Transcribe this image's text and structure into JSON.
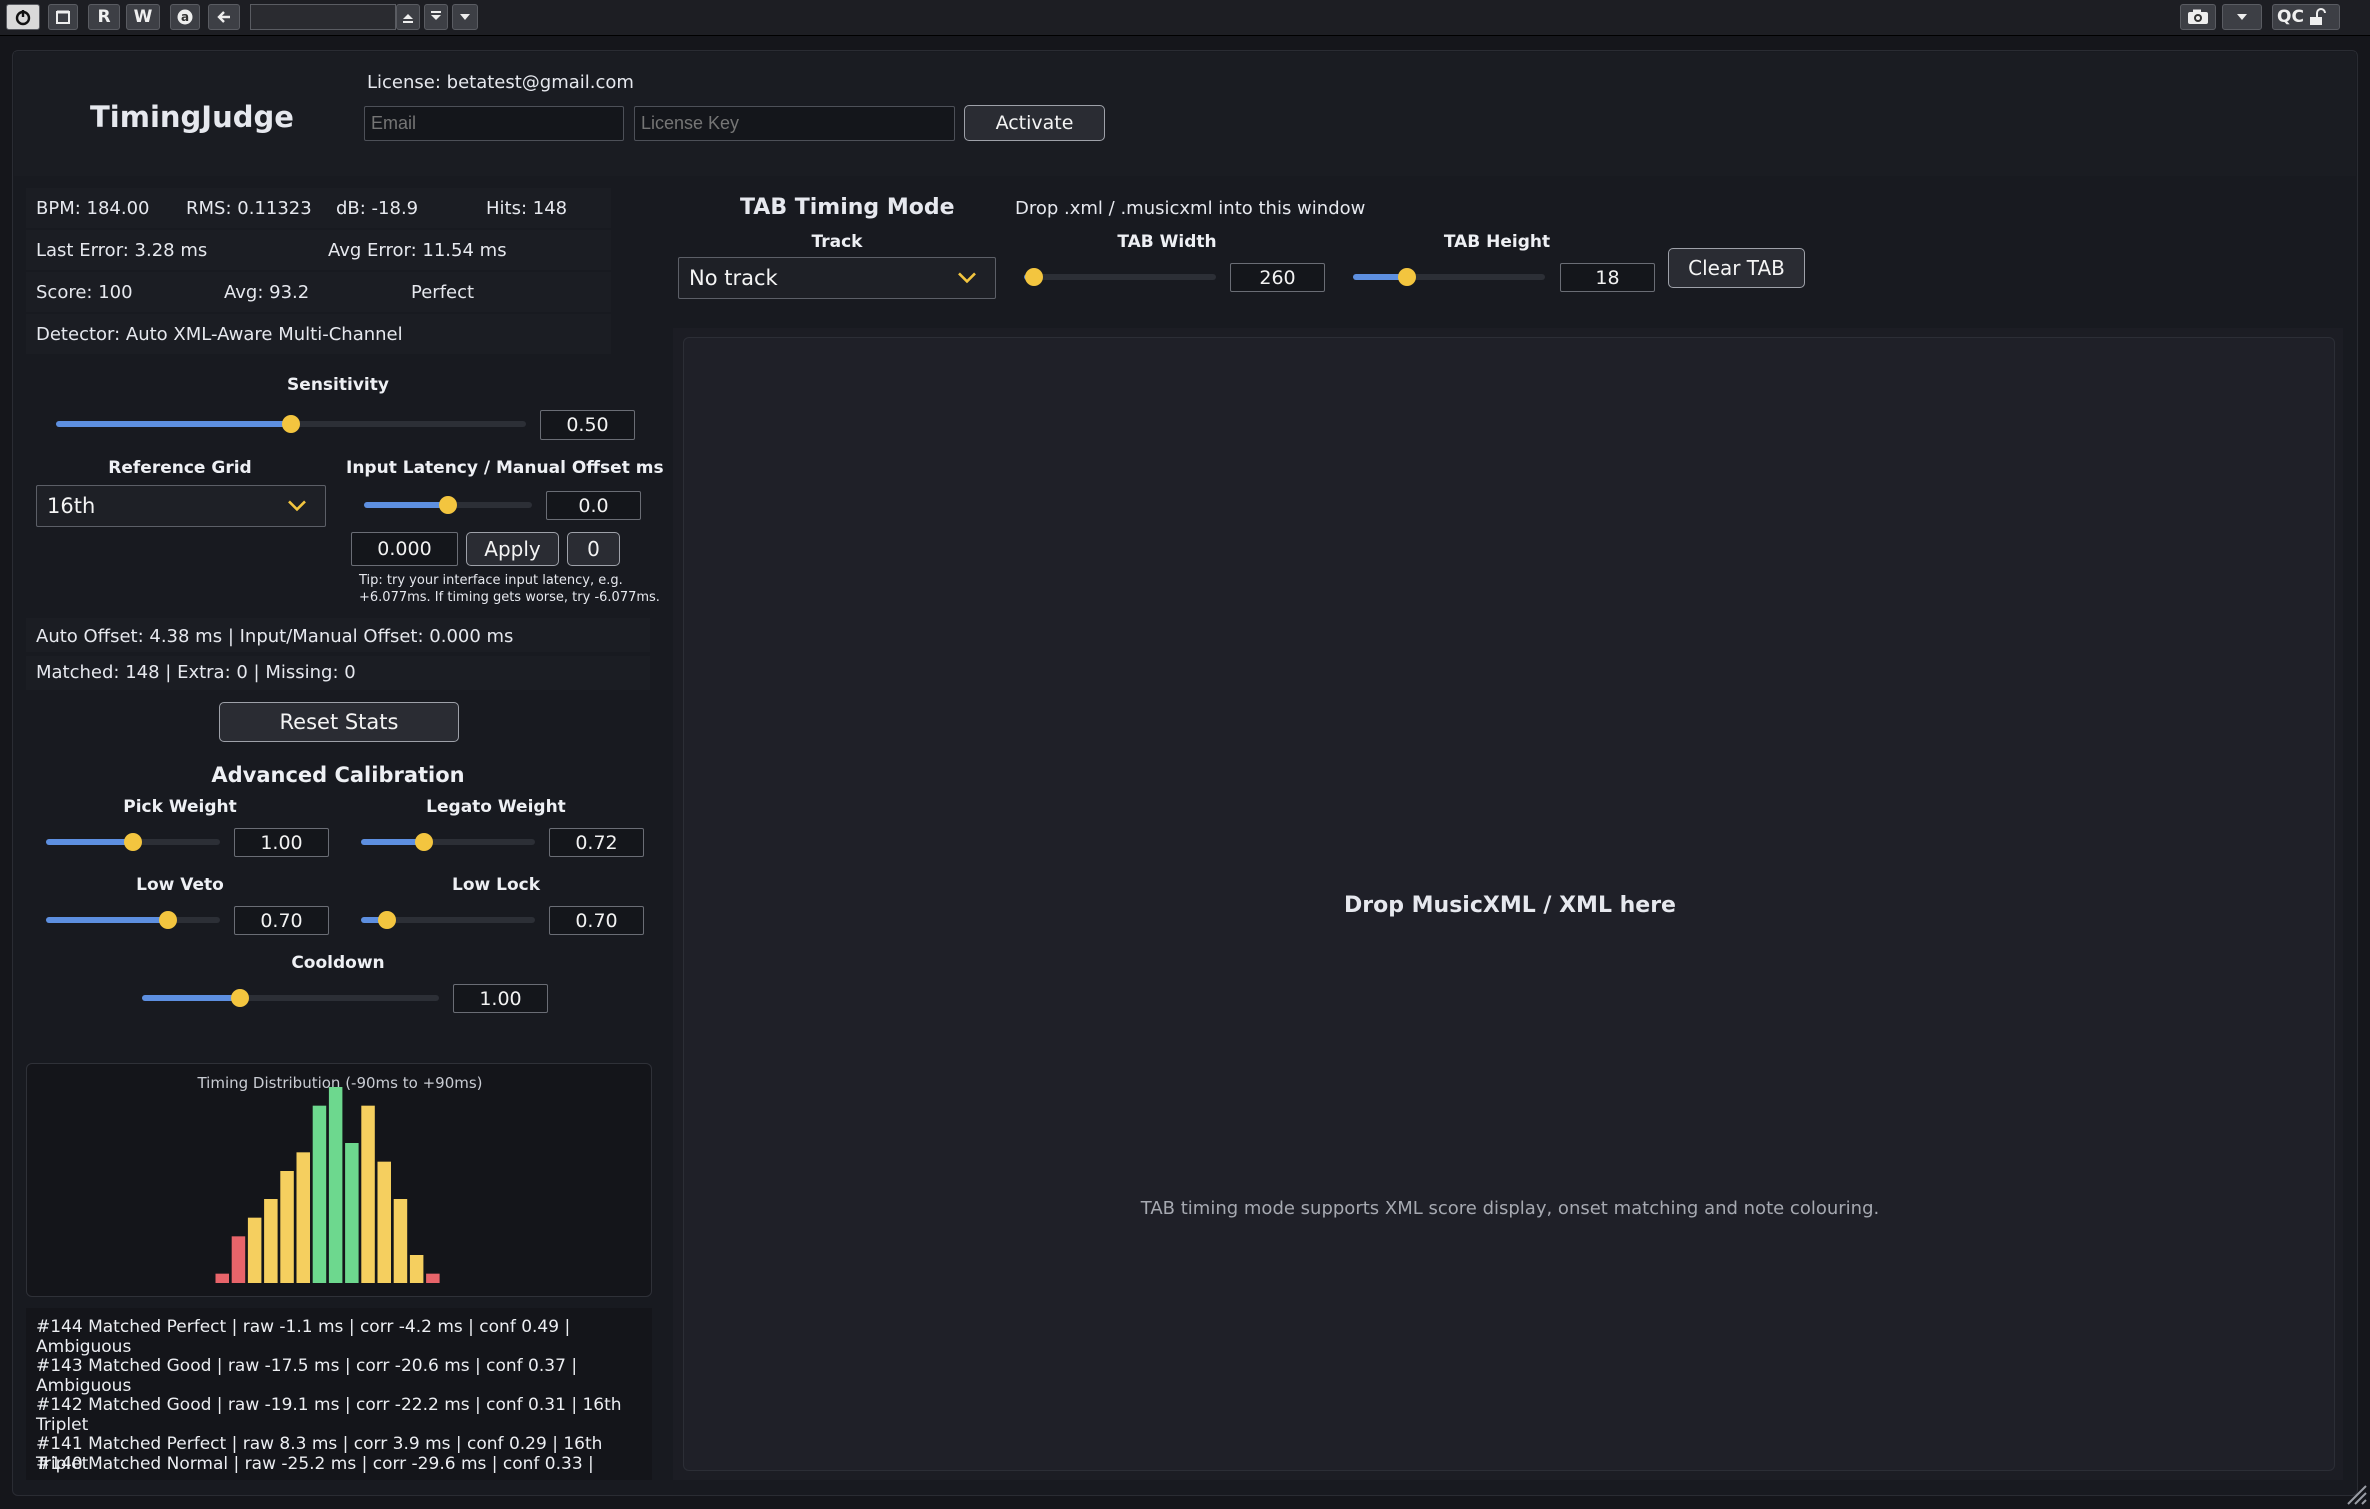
{
  "host_toolbar": {
    "buttons": [
      "R",
      "W"
    ],
    "right_label": "QC"
  },
  "header": {
    "app_title": "TimingJudge",
    "license_text": "License: betatest@gmail.com",
    "email_placeholder": "Email",
    "key_placeholder": "License Key",
    "activate_label": "Activate"
  },
  "stats": {
    "bpm": "BPM: 184.00",
    "rms": "RMS: 0.11323",
    "db": "dB: -18.9",
    "hits": "Hits: 148",
    "last_error": "Last Error: 3.28 ms",
    "avg_error": "Avg Error: 11.54 ms",
    "score": "Score: 100",
    "avg": "Avg: 93.2",
    "grade": "Perfect",
    "detector": "Detector: Auto XML-Aware Multi-Channel"
  },
  "sensitivity": {
    "label": "Sensitivity",
    "value": "0.50",
    "level": 0.5
  },
  "reference_grid": {
    "label": "Reference Grid",
    "selected": "16th"
  },
  "latency": {
    "label": "Input Latency / Manual Offset ms",
    "value": "0.0",
    "level": 0.5,
    "manual_value": "0.000",
    "apply_label": "Apply",
    "zero_label": "0",
    "tip_line1": "Tip: try your interface input latency, e.g.",
    "tip_line2": "+6.077ms. If timing gets worse, try -6.077ms."
  },
  "offset_info": "Auto Offset: 4.38 ms | Input/Manual Offset: 0.000 ms",
  "match_info": "Matched: 148 | Extra: 0 | Missing: 0",
  "reset_label": "Reset Stats",
  "advanced": {
    "title": "Advanced Calibration",
    "pick_weight": {
      "label": "Pick Weight",
      "value": "1.00",
      "level": 0.5
    },
    "legato_weight": {
      "label": "Legato Weight",
      "value": "0.72",
      "level": 0.36
    },
    "low_veto": {
      "label": "Low Veto",
      "value": "0.70",
      "level": 0.7
    },
    "low_lock": {
      "label": "Low Lock",
      "value": "0.70",
      "level": 0.15
    },
    "cooldown": {
      "label": "Cooldown",
      "value": "1.00",
      "level": 0.33
    }
  },
  "tab_mode": {
    "title": "TAB Timing Mode",
    "drop_hint": "Drop .xml / .musicxml into this window",
    "track_label": "Track",
    "track_selected": "No track",
    "width_label": "TAB Width",
    "width_value": "260",
    "width_level": 0.05,
    "height_label": "TAB Height",
    "height_value": "18",
    "height_level": 0.28,
    "clear_label": "Clear TAB",
    "drop_title": "Drop MusicXML / XML here",
    "support_text": "TAB timing mode supports XML score display, onset matching and note colouring."
  },
  "chart_data": {
    "type": "bar",
    "title": "Timing Distribution (-90ms to +90ms)",
    "xlim": [
      -90,
      90
    ],
    "values": [
      5,
      25,
      35,
      45,
      60,
      70,
      95,
      105,
      75,
      95,
      65,
      45,
      15,
      5
    ],
    "bar_colors": [
      "#e8646a",
      "#e8646a",
      "#f5cf5f",
      "#f5cf5f",
      "#f5cf5f",
      "#f5cf5f",
      "#6dd88e",
      "#6dd88e",
      "#6dd88e",
      "#f5cf5f",
      "#f5cf5f",
      "#f5cf5f",
      "#f5cf5f",
      "#e8646a"
    ]
  },
  "log": [
    "#144 Matched Perfect | raw -1.1 ms | corr -4.2 ms | conf 0.49 |",
    "Ambiguous",
    "#143 Matched Good | raw -17.5 ms | corr -20.6 ms | conf 0.37 |",
    "Ambiguous",
    "#142 Matched Good | raw -19.1 ms | corr -22.2 ms | conf 0.31 | 16th",
    "Triplet",
    "#141 Matched Perfect | raw 8.3 ms | corr 3.9 ms | conf 0.29 | 16th Triplet",
    "#140 Matched Normal | raw -25.2 ms | corr -29.6 ms | conf 0.33 |"
  ]
}
